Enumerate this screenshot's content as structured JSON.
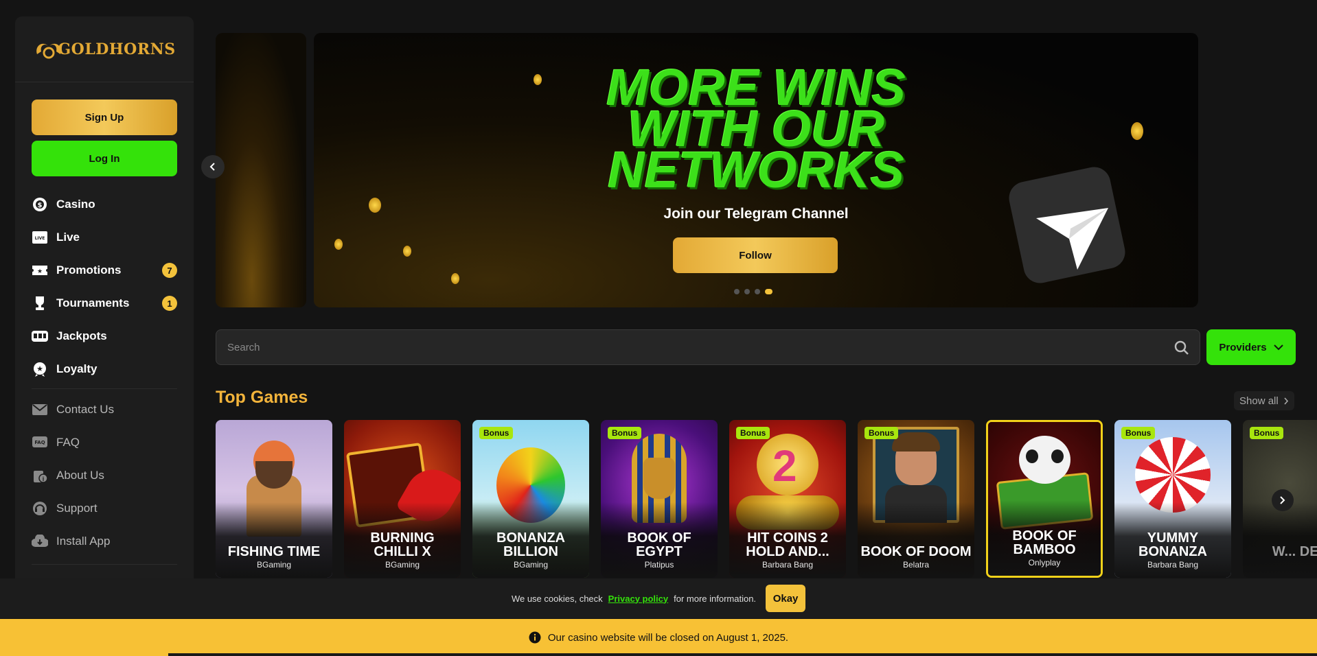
{
  "brand": {
    "logo_text": "GOLDHORNS"
  },
  "auth": {
    "signup_label": "Sign Up",
    "login_label": "Log In"
  },
  "nav": {
    "primary": [
      {
        "label": "Casino",
        "icon": "casino-chip-icon"
      },
      {
        "label": "Live",
        "icon": "live-icon"
      },
      {
        "label": "Promotions",
        "icon": "ticket-icon",
        "badge": "7"
      },
      {
        "label": "Tournaments",
        "icon": "trophy-icon",
        "badge": "1"
      },
      {
        "label": "Jackpots",
        "icon": "slot-machine-icon"
      },
      {
        "label": "Loyalty",
        "icon": "loyalty-badge-icon"
      }
    ],
    "secondary": [
      {
        "label": "Contact Us",
        "icon": "mail-icon"
      },
      {
        "label": "FAQ",
        "icon": "faq-icon"
      },
      {
        "label": "About Us",
        "icon": "info-icon"
      },
      {
        "label": "Support",
        "icon": "headset-icon"
      },
      {
        "label": "Install App",
        "icon": "download-icon"
      }
    ]
  },
  "banner": {
    "title_line1": "MORE WINS",
    "title_line2": "WITH OUR",
    "title_line3": "NETWORKS",
    "subtitle": "Join our Telegram Channel",
    "cta_label": "Follow",
    "slide_count": 4,
    "active_slide": 4
  },
  "search": {
    "placeholder": "Search"
  },
  "providers_label": "Providers",
  "top_games": {
    "title": "Top Games",
    "show_all_label": "Show all",
    "games": [
      {
        "title": "FISHING TIME",
        "provider": "BGaming",
        "bonus": false
      },
      {
        "title": "BURNING CHILLI X",
        "provider": "BGaming",
        "bonus": false
      },
      {
        "title": "BONANZA BILLION",
        "provider": "BGaming",
        "bonus": true
      },
      {
        "title": "BOOK OF EGYPT",
        "provider": "Platipus",
        "bonus": true
      },
      {
        "title": "HIT COINS 2 HOLD AND...",
        "provider": "Barbara Bang",
        "bonus": true
      },
      {
        "title": "BOOK OF DOOM",
        "provider": "Belatra",
        "bonus": true
      },
      {
        "title": "BOOK OF BAMBOO",
        "provider": "Onlyplay",
        "bonus": false
      },
      {
        "title": "YUMMY BONANZA",
        "provider": "Barbara Bang",
        "bonus": true
      },
      {
        "title": "W... DE...",
        "provider": "",
        "bonus": true
      }
    ],
    "bonus_label": "Bonus"
  },
  "cookie": {
    "text_before": "We use cookies, check",
    "link_label": "Privacy policy",
    "text_after": "for more information.",
    "okay_label": "Okay"
  },
  "notice": {
    "text": "Our casino website will be closed on August 1, 2025."
  },
  "colors": {
    "gold": "#f3c23b",
    "green": "#34e20a",
    "bg": "#141414",
    "sidebar": "#1d1d1d"
  }
}
